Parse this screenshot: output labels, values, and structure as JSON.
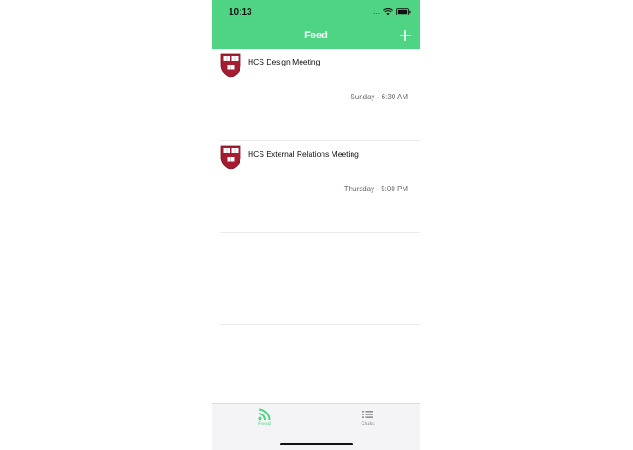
{
  "status_bar": {
    "time": "10:13",
    "dots": "....",
    "icons": [
      "wifi-icon",
      "battery-icon"
    ]
  },
  "header": {
    "title": "Feed",
    "add_icon": "plus-icon",
    "background": "#4fd483"
  },
  "feed": {
    "items": [
      {
        "title": "HCS Design Meeting",
        "time": "Sunday - 6:30 AM",
        "icon": "harvard-crest-icon"
      },
      {
        "title": "HCS External Relations Meeting",
        "time": "Thursday - 5:00 PM",
        "icon": "harvard-crest-icon"
      }
    ]
  },
  "tabbar": {
    "tabs": [
      {
        "label": "Feed",
        "icon": "rss-feed-icon",
        "active": true,
        "color": "#4fd483"
      },
      {
        "label": "Clubs",
        "icon": "list-icon",
        "active": false,
        "color": "#8e8e93"
      }
    ]
  },
  "colors": {
    "accent": "#4fd483",
    "crest_red": "#a51c30"
  }
}
